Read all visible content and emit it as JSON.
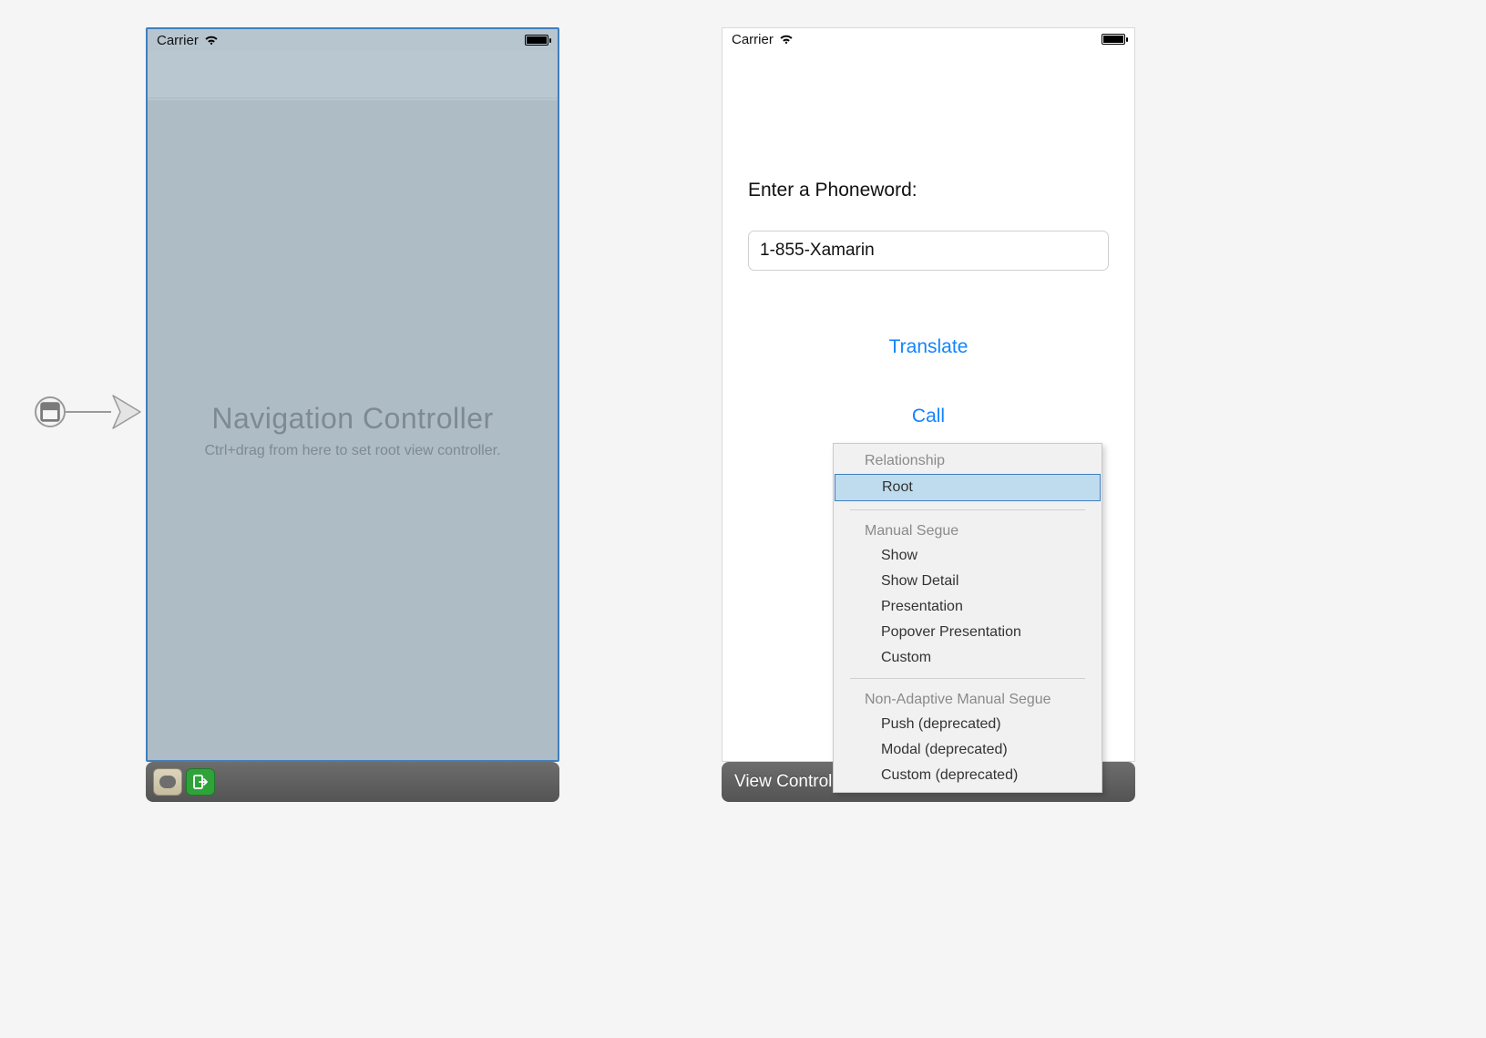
{
  "left": {
    "statusbar": {
      "carrier": "Carrier"
    },
    "title": "Navigation Controller",
    "subtitle": "Ctrl+drag from here to set root view controller."
  },
  "right": {
    "statusbar": {
      "carrier": "Carrier"
    },
    "label": "Enter a Phoneword:",
    "textfield_value": "1-855-Xamarin",
    "translate_button": "Translate",
    "call_button": "Call",
    "scene_title": "View Controller"
  },
  "segue": {
    "section1_header": "Relationship",
    "root": "Root",
    "section2_header": "Manual Segue",
    "show": "Show",
    "show_detail": "Show Detail",
    "presentation": "Presentation",
    "popover": "Popover Presentation",
    "custom": "Custom",
    "section3_header": "Non-Adaptive Manual Segue",
    "push_dep": "Push (deprecated)",
    "modal_dep": "Modal (deprecated)",
    "custom_dep": "Custom (deprecated)"
  }
}
